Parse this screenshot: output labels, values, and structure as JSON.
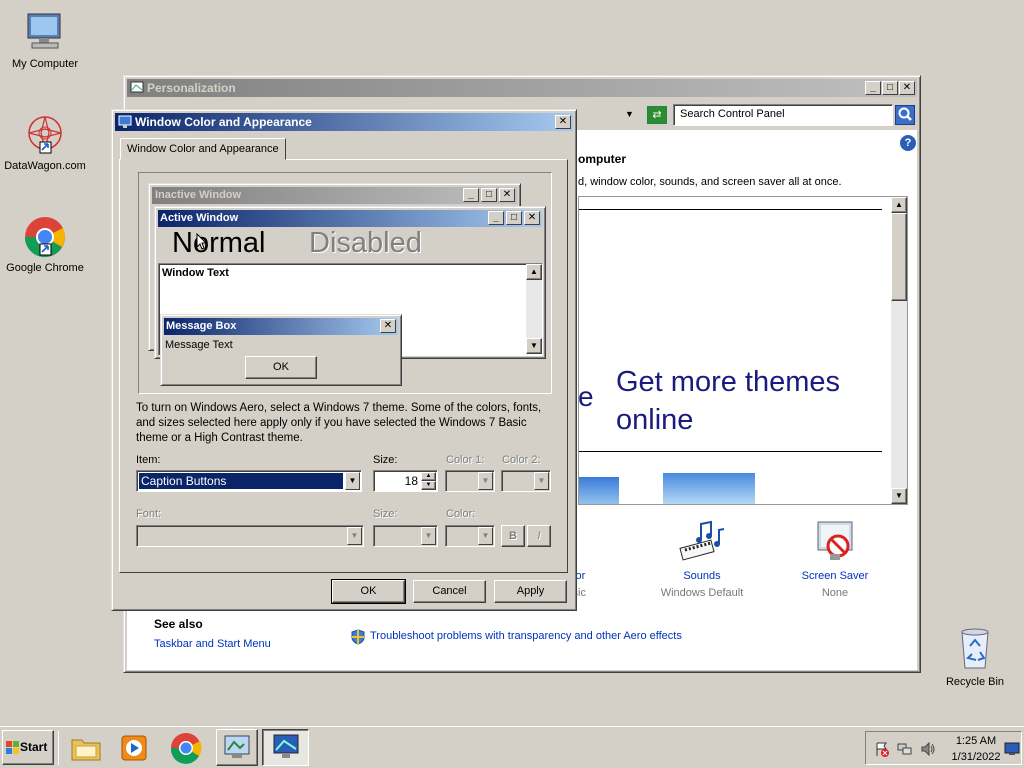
{
  "desktop": {
    "icons": [
      {
        "label": "My Computer"
      },
      {
        "label": "DataWagon.com"
      },
      {
        "label": "Google Chrome"
      },
      {
        "label": "Recycle Bin"
      }
    ]
  },
  "personalization": {
    "title": "Personalization",
    "search_placeholder": "Search Control Panel",
    "heading_fragment": "omputer",
    "desc_fragment": "d, window color, sounds, and screen saver all at once.",
    "more_themes_line1": "Get more themes",
    "more_themes_line2": "online",
    "e_fragment": "e",
    "bottom_items": [
      {
        "label": "olor",
        "sub": "ssic"
      },
      {
        "label": "Sounds",
        "sub": "Windows Default"
      },
      {
        "label": "Screen Saver",
        "sub": "None"
      }
    ],
    "see_also": "See also",
    "taskbar_link": "Taskbar and Start Menu",
    "troubleshoot_link": "Troubleshoot problems with transparency and other Aero effects"
  },
  "dialog": {
    "title": "Window Color and Appearance",
    "tab": "Window Color and Appearance",
    "preview": {
      "inactive_title": "Inactive Window",
      "active_title": "Active Window",
      "normal": "Normal",
      "disabled": "Disabled",
      "window_text": "Window Text",
      "msgbox_title": "Message Box",
      "msgbox_text": "Message Text",
      "msgbox_ok": "OK"
    },
    "description": "To turn on Windows Aero, select a Windows 7 theme.  Some of the colors, fonts, and sizes selected here apply only if you have selected the Windows 7 Basic theme or a High Contrast theme.",
    "item_label": "Item:",
    "item_value": "Caption Buttons",
    "size_label": "Size:",
    "size_value": "18",
    "color1_label": "Color 1:",
    "color2_label": "Color 2:",
    "font_label": "Font:",
    "font_size_label": "Size:",
    "font_color_label": "Color:",
    "bold_label": "B",
    "italic_label": "I",
    "ok": "OK",
    "cancel": "Cancel",
    "apply": "Apply"
  },
  "taskbar": {
    "start": "Start",
    "time": "1:25 AM",
    "date": "1/31/2022"
  },
  "colors": {
    "active_title_start": "#0a246a",
    "active_title_end": "#a6caf0",
    "link": "#0033bb",
    "theme_text": "#1a1a80"
  }
}
